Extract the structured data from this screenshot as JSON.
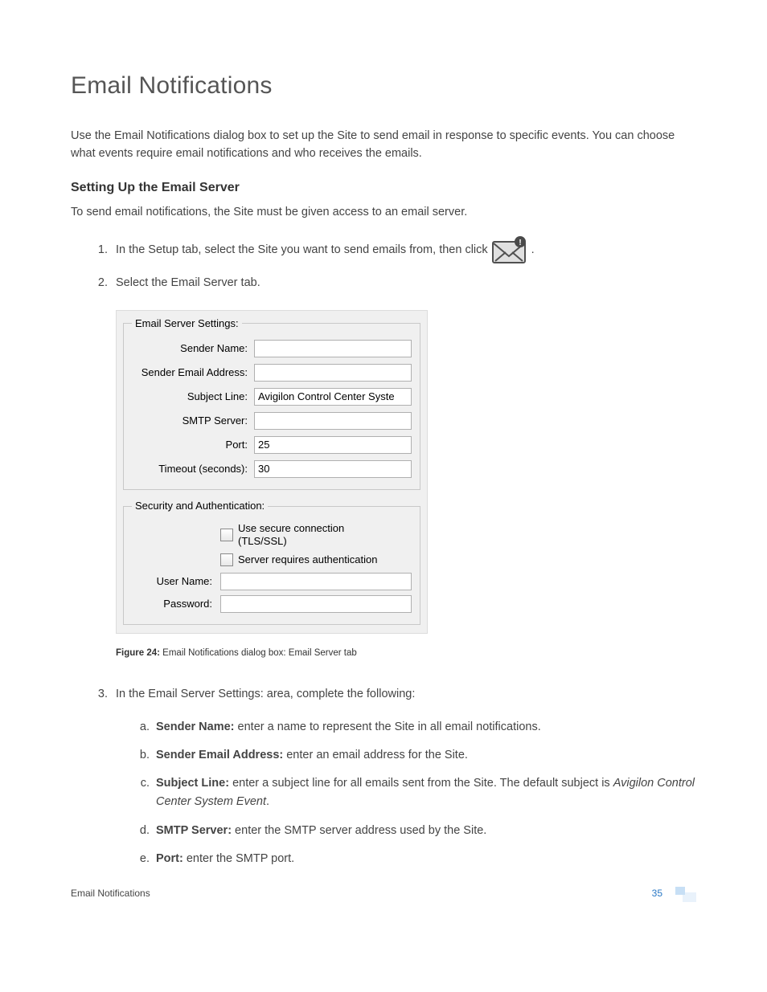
{
  "heading": "Email Notifications",
  "intro": "Use the Email Notifications dialog box to set up the Site to send email in response to specific events. You can choose what events require email notifications and who receives the emails.",
  "section_heading": "Setting Up the Email Server",
  "section_intro": "To send email notifications, the Site must be given access to an email server.",
  "steps": {
    "s1_a": "In the Setup tab, select the Site you want to send emails from, then click",
    "s1_b": ".",
    "s2": "Select the Email Server tab.",
    "s3": "In the Email Server Settings: area, complete the following:"
  },
  "dialog": {
    "group1_title": "Email Server Settings:",
    "labels": {
      "sender_name": "Sender Name:",
      "sender_email": "Sender Email Address:",
      "subject": "Subject Line:",
      "smtp": "SMTP Server:",
      "port": "Port:",
      "timeout": "Timeout (seconds):"
    },
    "values": {
      "sender_name": "",
      "sender_email": "",
      "subject": "Avigilon Control Center Syste",
      "smtp": "",
      "port": "25",
      "timeout": "30"
    },
    "group2_title": "Security and Authentication:",
    "sec": {
      "use_secure": "Use secure connection (TLS/SSL)",
      "requires_auth": "Server requires authentication",
      "username_label": "User Name:",
      "password_label": "Password:"
    }
  },
  "figure": {
    "label": "Figure 24:",
    "text": "Email Notifications dialog box: Email Server tab"
  },
  "sub_items": {
    "a_term": "Sender Name:",
    "a_rest": " enter a name to represent the Site in all email notifications.",
    "b_term": "Sender Email Address:",
    "b_rest": " enter an email address for the Site.",
    "c_term": "Subject Line:",
    "c_rest_a": " enter a subject line for all emails sent from the Site. The default subject is ",
    "c_italic": "Avigilon Control Center System Event",
    "c_rest_b": ".",
    "d_term": "SMTP Server:",
    "d_rest": " enter the SMTP server address used by the Site.",
    "e_term": "Port:",
    "e_rest": " enter the SMTP port."
  },
  "footer": {
    "left": "Email Notifications",
    "page": "35"
  }
}
